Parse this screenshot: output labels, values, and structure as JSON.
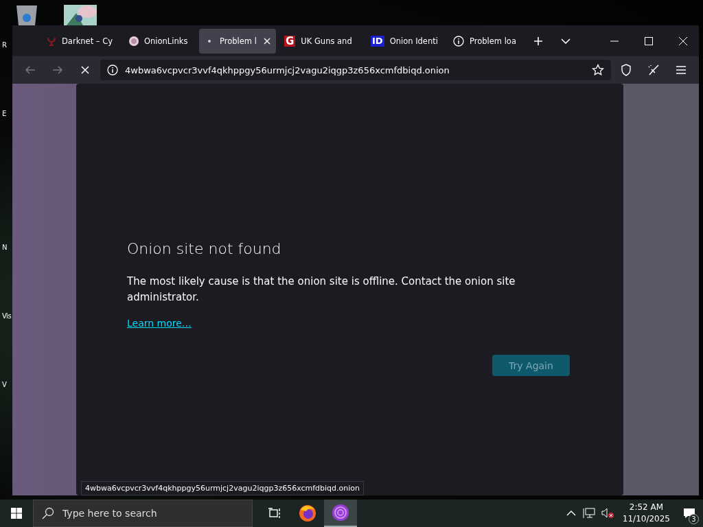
{
  "desktop": {
    "icon_labels": [
      "R",
      "E",
      "N",
      "Vis",
      "V"
    ]
  },
  "browser": {
    "tabs": [
      {
        "label": "Darknet – Cy",
        "selected": false,
        "kind": "emblem"
      },
      {
        "label": "OnionLinks",
        "selected": false,
        "kind": "avatar"
      },
      {
        "label": "Problem l",
        "selected": true,
        "kind": "dot"
      },
      {
        "label": "UK Guns and",
        "selected": false,
        "kind": "letter",
        "badge": "G",
        "color": "#b5121b"
      },
      {
        "label": "Onion Identi",
        "selected": false,
        "kind": "letter",
        "badge": "ID",
        "color": "#1a1fd0"
      },
      {
        "label": "Problem loa",
        "selected": false,
        "kind": "info"
      }
    ],
    "url": "4wbwa6vcpvcr3vvf4qkhppgy56urmjcj2vagu2iqgp3z656xcmfdbiqd.onion",
    "loading": true,
    "page": {
      "title": "Onion site not found",
      "message": "The most likely cause is that the onion site is offline. Contact the onion site administrator.",
      "link": "Learn more…",
      "button": "Try Again"
    },
    "status_link": "4wbwa6vcpvcr3vvf4qkhppgy56urmjcj2vagu2iqgp3z656xcmfdbiqd.onion"
  },
  "taskbar": {
    "search_placeholder": "Type here to search",
    "time": "2:52 AM",
    "date": "11/10/2025",
    "notification_count": "3"
  }
}
